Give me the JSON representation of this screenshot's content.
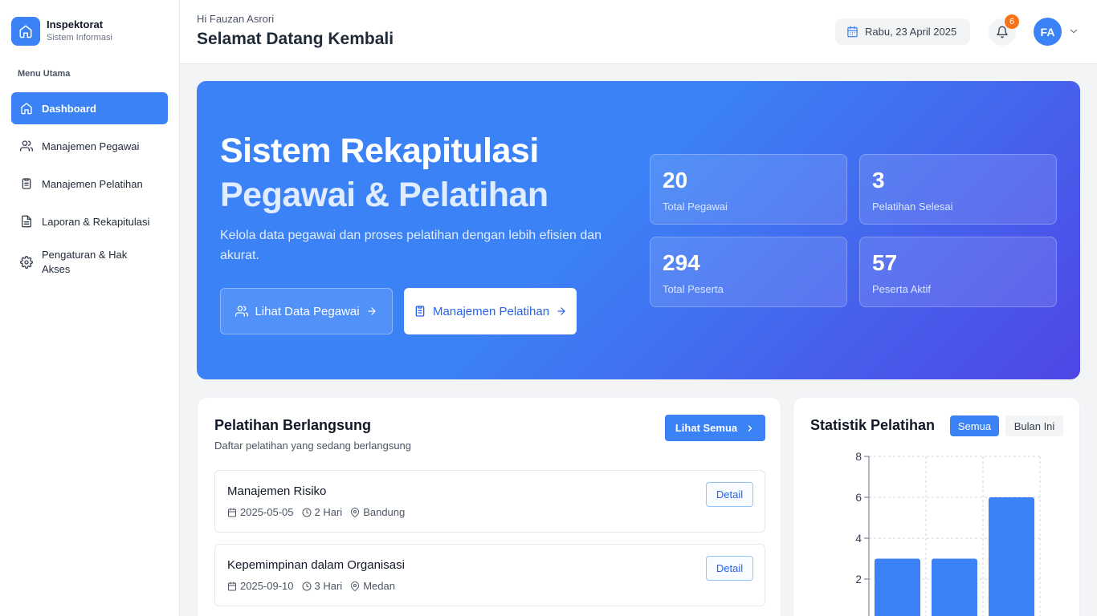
{
  "brand": {
    "title": "Inspektorat",
    "subtitle": "Sistem Informasi"
  },
  "sidebar": {
    "heading": "Menu Utama",
    "items": [
      {
        "label": "Dashboard",
        "icon": "home-icon",
        "active": true
      },
      {
        "label": "Manajemen Pegawai",
        "icon": "users-icon"
      },
      {
        "label": "Manajemen Pelatihan",
        "icon": "clipboard-icon"
      },
      {
        "label": "Laporan & Rekapitulasi",
        "icon": "file-text-icon"
      },
      {
        "label": "Pengaturan & Hak Akses",
        "icon": "gear-icon"
      }
    ]
  },
  "header": {
    "greeting": "Hi Fauzan Asrori",
    "welcome": "Selamat Datang Kembali",
    "date": "Rabu, 23 April 2025",
    "notification_count": "6",
    "avatar_initials": "FA"
  },
  "hero": {
    "title_line1": "Sistem Rekapitulasi",
    "title_line2": "Pegawai & Pelatihan",
    "description": "Kelola data pegawai dan proses pelatihan dengan lebih efisien dan akurat.",
    "btn_employees": "Lihat Data Pegawai",
    "btn_training": "Manajemen Pelatihan",
    "stats": [
      {
        "value": "20",
        "label": "Total Pegawai"
      },
      {
        "value": "3",
        "label": "Pelatihan Selesai"
      },
      {
        "value": "294",
        "label": "Total Peserta"
      },
      {
        "value": "57",
        "label": "Peserta Aktif"
      }
    ]
  },
  "ongoing": {
    "title": "Pelatihan Berlangsung",
    "subtitle": "Daftar pelatihan yang sedang berlangsung",
    "see_all": "Lihat Semua",
    "detail_label": "Detail",
    "items": [
      {
        "name": "Manajemen Risiko",
        "date": "2025-05-05",
        "duration": "2 Hari",
        "location": "Bandung"
      },
      {
        "name": "Kepemimpinan dalam Organisasi",
        "date": "2025-09-10",
        "duration": "3 Hari",
        "location": "Medan"
      }
    ]
  },
  "stats_card": {
    "title": "Statistik Pelatihan",
    "tab_all": "Semua",
    "tab_month": "Bulan Ini"
  },
  "chart_data": {
    "type": "bar",
    "categories": [
      "",
      "",
      ""
    ],
    "values": [
      3,
      3,
      6
    ],
    "yticks": [
      "8",
      "6",
      "4",
      "2"
    ],
    "ylim": [
      0,
      8
    ],
    "grid": true,
    "color": "#3b82f6"
  },
  "colors": {
    "primary": "#3b82f6",
    "badge": "#f97316"
  }
}
